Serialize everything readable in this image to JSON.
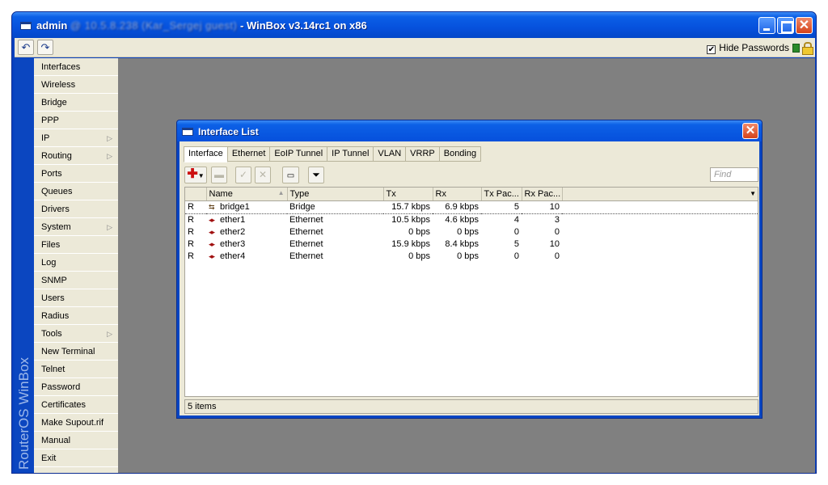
{
  "window": {
    "title_user": "admin",
    "title_host": "@ 10.5.8.238 (Kar_Sergej guest)",
    "title_app": " - WinBox v3.14rc1 on x86"
  },
  "toolbar": {
    "undo_icon": "undo-icon",
    "redo_icon": "redo-icon",
    "hide_passwords_label": "Hide Passwords",
    "hide_passwords_checked": true
  },
  "brand": {
    "part1": "RouterOS",
    "part2": "WinBox"
  },
  "sidebar": {
    "items": [
      {
        "label": "Interfaces",
        "submenu": false
      },
      {
        "label": "Wireless",
        "submenu": false
      },
      {
        "label": "Bridge",
        "submenu": false
      },
      {
        "label": "PPP",
        "submenu": false
      },
      {
        "label": "IP",
        "submenu": true
      },
      {
        "label": "Routing",
        "submenu": true
      },
      {
        "label": "Ports",
        "submenu": false
      },
      {
        "label": "Queues",
        "submenu": false
      },
      {
        "label": "Drivers",
        "submenu": false
      },
      {
        "label": "System",
        "submenu": true
      },
      {
        "label": "Files",
        "submenu": false
      },
      {
        "label": "Log",
        "submenu": false
      },
      {
        "label": "SNMP",
        "submenu": false
      },
      {
        "label": "Users",
        "submenu": false
      },
      {
        "label": "Radius",
        "submenu": false
      },
      {
        "label": "Tools",
        "submenu": true
      },
      {
        "label": "New Terminal",
        "submenu": false
      },
      {
        "label": "Telnet",
        "submenu": false
      },
      {
        "label": "Password",
        "submenu": false
      },
      {
        "label": "Certificates",
        "submenu": false
      },
      {
        "label": "Make Supout.rif",
        "submenu": false
      },
      {
        "label": "Manual",
        "submenu": false
      },
      {
        "label": "Exit",
        "submenu": false
      }
    ]
  },
  "dialog": {
    "title": "Interface List",
    "tabs": [
      "Interface",
      "Ethernet",
      "EoIP Tunnel",
      "IP Tunnel",
      "VLAN",
      "VRRP",
      "Bonding"
    ],
    "active_tab": "Interface",
    "find_placeholder": "Find",
    "columns": [
      "",
      "Name",
      "Type",
      "Tx",
      "Rx",
      "Tx Pac...",
      "Rx Pac..."
    ],
    "rows": [
      {
        "flag": "R",
        "icon": "bridge-icon",
        "name": "bridge1",
        "type": "Bridge",
        "tx": "15.7 kbps",
        "rx": "6.9 kbps",
        "tx_pkts": "5",
        "rx_pkts": "10"
      },
      {
        "flag": "R",
        "icon": "ethernet-icon",
        "name": "ether1",
        "type": "Ethernet",
        "tx": "10.5 kbps",
        "rx": "4.6 kbps",
        "tx_pkts": "4",
        "rx_pkts": "3"
      },
      {
        "flag": "R",
        "icon": "ethernet-icon",
        "name": "ether2",
        "type": "Ethernet",
        "tx": "0 bps",
        "rx": "0 bps",
        "tx_pkts": "0",
        "rx_pkts": "0"
      },
      {
        "flag": "R",
        "icon": "ethernet-icon",
        "name": "ether3",
        "type": "Ethernet",
        "tx": "15.9 kbps",
        "rx": "8.4 kbps",
        "tx_pkts": "5",
        "rx_pkts": "10"
      },
      {
        "flag": "R",
        "icon": "ethernet-icon",
        "name": "ether4",
        "type": "Ethernet",
        "tx": "0 bps",
        "rx": "0 bps",
        "tx_pkts": "0",
        "rx_pkts": "0"
      }
    ],
    "status": "5 items"
  }
}
